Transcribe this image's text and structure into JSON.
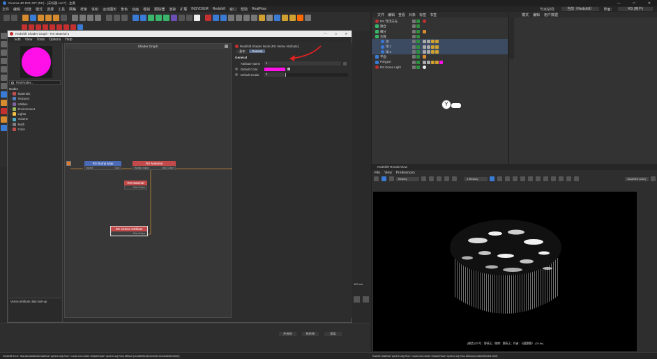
{
  "app": {
    "title": "Cinema 4D R21.207 (RC) - [未标题.c4d *] - 主要",
    "window_controls": [
      "—",
      "□",
      "✕"
    ]
  },
  "menubar": {
    "items": [
      "文件",
      "编辑",
      "创建",
      "模式",
      "选择",
      "工具",
      "网格",
      "样条",
      "体积",
      "运动图形",
      "角色",
      "动画",
      "模拟",
      "跟踪器",
      "渲染",
      "扩展",
      "INSYDIUM",
      "Redshift",
      "窗口",
      "帮助",
      "RealFlow"
    ],
    "right": [
      "节点空间：",
      "当前（Redshift）",
      "界面：",
      "RS (用户)"
    ]
  },
  "shader_window": {
    "title": "Redshift Shader Graph - RS Material 2",
    "menu": [
      "Edit",
      "View",
      "Tools",
      "Options",
      "Help"
    ],
    "graph_title": "Shader Graph",
    "find_nodes": "Find Nodes...",
    "nodes_header": "Nodes",
    "categories": [
      {
        "name": "Materials",
        "color": "#c0504d"
      },
      {
        "name": "Textures",
        "color": "#4f81bd"
      },
      {
        "name": "Utilities",
        "color": "#8064a2"
      },
      {
        "name": "Environment",
        "color": "#9bbb59"
      },
      {
        "name": "Lights",
        "color": "#f5c242"
      },
      {
        "name": "Volume",
        "color": "#4bacc6"
      },
      {
        "name": "Math",
        "color": "#7f7f7f"
      },
      {
        "name": "Color",
        "color": "#c0504d"
      }
    ],
    "description": "Vertex attribute data look-up",
    "nodes": {
      "bump": {
        "title": "RS Bump Map",
        "in": "Input",
        "out": "Out"
      },
      "material": {
        "title": "RS Material",
        "in": "Bump Input",
        "out": "Out Color"
      },
      "material2": {
        "title": "RS Material",
        "out": "Out Color"
      },
      "vertex": {
        "title": "RS Vertex Attribute",
        "out": "Out Color"
      }
    },
    "attr": {
      "header": "Redshift Shader Node [RS Vertex Attribute]",
      "tabs": [
        "基本",
        "General"
      ],
      "section": "General",
      "attribute_name_label": "Attribute Name",
      "attribute_name_value": "4",
      "default_color_label": "Default Color",
      "default_color": "#ff10e8",
      "default_scalar_label": "Default Scalar",
      "default_scalar_value": "0"
    }
  },
  "object_manager": {
    "menu": [
      "文件",
      "编辑",
      "查看",
      "对象",
      "标签",
      "书签"
    ],
    "objects": [
      {
        "name": "RS 穹顶天光",
        "indent": 0
      },
      {
        "name": "融合",
        "indent": 0
      },
      {
        "name": "细分",
        "indent": 0
      },
      {
        "name": "克隆",
        "indent": 0
      },
      {
        "name": "球",
        "indent": 1
      },
      {
        "name": "球.1",
        "indent": 1
      },
      {
        "name": "球.2",
        "indent": 1
      },
      {
        "name": "平面",
        "indent": 0
      },
      {
        "name": "Polygon",
        "indent": 0
      },
      {
        "name": "RS Dome Light",
        "indent": 0
      }
    ]
  },
  "attribute_manager": {
    "menu": [
      "模式",
      "编辑",
      "用户数据"
    ]
  },
  "renderview": {
    "title": "Redshift RenderView",
    "menu": [
      "File",
      "View",
      "Preferences"
    ],
    "beauty": "Beauty",
    "aov": "1 Beauty",
    "display": "Disabled (Use)",
    "caption": "(微信公众号：野燕王；微博：野燕王；作者：马鹿鹅鹅）   (24.6s)",
    "zoom": "100 cm"
  },
  "status": {
    "left": "Redshift Error: StandardMaterial Material 'sphere.obj.Rloo': Could not create ShaderNode 'sphere.obj.Rloo.Diffuse'(c13d6d9b3d01230f213c3d0ab5b10000)",
    "right": "Shader Material 'sphere.obj.Rloo': Could not create ShaderNode 'sphere.obj.Rloo.Diffuse(c13d6d9b3d01230f)'",
    "timeline": [
      "开启帧",
      "结束帧",
      "播放",
      "渲染"
    ]
  },
  "colors": {
    "accent": "#e32222",
    "magenta": "#ff10e8",
    "node_blue": "#4b6ab5",
    "node_red": "#c34a4a"
  }
}
